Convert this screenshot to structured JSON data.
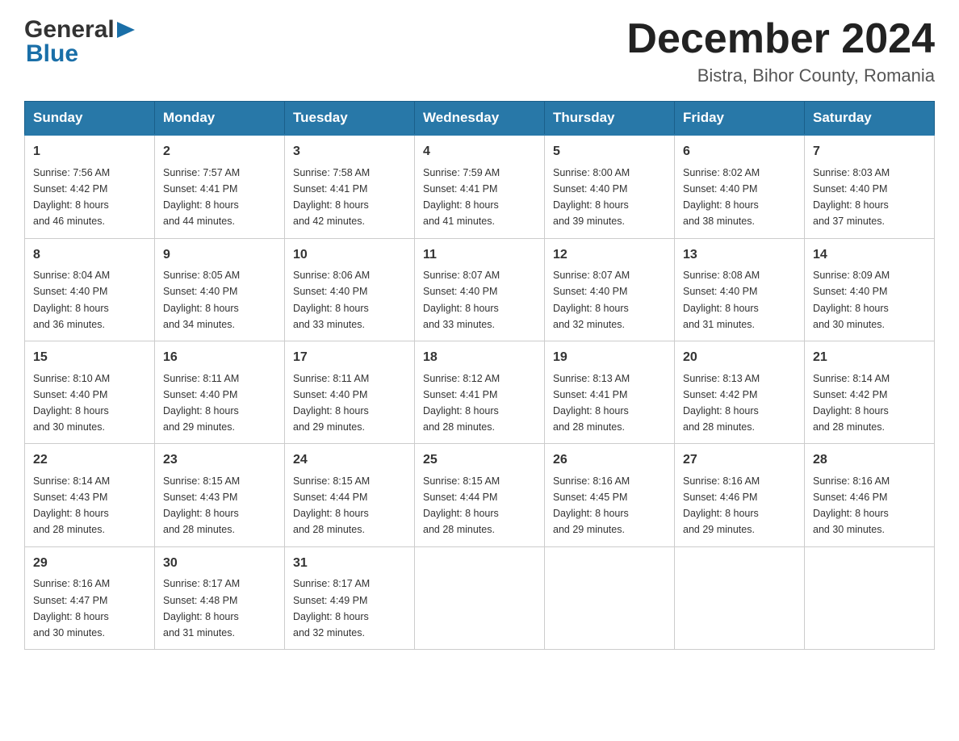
{
  "logo": {
    "general": "General",
    "triangle": "▶",
    "blue": "Blue"
  },
  "title": "December 2024",
  "subtitle": "Bistra, Bihor County, Romania",
  "days_of_week": [
    "Sunday",
    "Monday",
    "Tuesday",
    "Wednesday",
    "Thursday",
    "Friday",
    "Saturday"
  ],
  "weeks": [
    [
      {
        "day": "1",
        "sunrise": "7:56 AM",
        "sunset": "4:42 PM",
        "daylight": "8 hours and 46 minutes."
      },
      {
        "day": "2",
        "sunrise": "7:57 AM",
        "sunset": "4:41 PM",
        "daylight": "8 hours and 44 minutes."
      },
      {
        "day": "3",
        "sunrise": "7:58 AM",
        "sunset": "4:41 PM",
        "daylight": "8 hours and 42 minutes."
      },
      {
        "day": "4",
        "sunrise": "7:59 AM",
        "sunset": "4:41 PM",
        "daylight": "8 hours and 41 minutes."
      },
      {
        "day": "5",
        "sunrise": "8:00 AM",
        "sunset": "4:40 PM",
        "daylight": "8 hours and 39 minutes."
      },
      {
        "day": "6",
        "sunrise": "8:02 AM",
        "sunset": "4:40 PM",
        "daylight": "8 hours and 38 minutes."
      },
      {
        "day": "7",
        "sunrise": "8:03 AM",
        "sunset": "4:40 PM",
        "daylight": "8 hours and 37 minutes."
      }
    ],
    [
      {
        "day": "8",
        "sunrise": "8:04 AM",
        "sunset": "4:40 PM",
        "daylight": "8 hours and 36 minutes."
      },
      {
        "day": "9",
        "sunrise": "8:05 AM",
        "sunset": "4:40 PM",
        "daylight": "8 hours and 34 minutes."
      },
      {
        "day": "10",
        "sunrise": "8:06 AM",
        "sunset": "4:40 PM",
        "daylight": "8 hours and 33 minutes."
      },
      {
        "day": "11",
        "sunrise": "8:07 AM",
        "sunset": "4:40 PM",
        "daylight": "8 hours and 33 minutes."
      },
      {
        "day": "12",
        "sunrise": "8:07 AM",
        "sunset": "4:40 PM",
        "daylight": "8 hours and 32 minutes."
      },
      {
        "day": "13",
        "sunrise": "8:08 AM",
        "sunset": "4:40 PM",
        "daylight": "8 hours and 31 minutes."
      },
      {
        "day": "14",
        "sunrise": "8:09 AM",
        "sunset": "4:40 PM",
        "daylight": "8 hours and 30 minutes."
      }
    ],
    [
      {
        "day": "15",
        "sunrise": "8:10 AM",
        "sunset": "4:40 PM",
        "daylight": "8 hours and 30 minutes."
      },
      {
        "day": "16",
        "sunrise": "8:11 AM",
        "sunset": "4:40 PM",
        "daylight": "8 hours and 29 minutes."
      },
      {
        "day": "17",
        "sunrise": "8:11 AM",
        "sunset": "4:40 PM",
        "daylight": "8 hours and 29 minutes."
      },
      {
        "day": "18",
        "sunrise": "8:12 AM",
        "sunset": "4:41 PM",
        "daylight": "8 hours and 28 minutes."
      },
      {
        "day": "19",
        "sunrise": "8:13 AM",
        "sunset": "4:41 PM",
        "daylight": "8 hours and 28 minutes."
      },
      {
        "day": "20",
        "sunrise": "8:13 AM",
        "sunset": "4:42 PM",
        "daylight": "8 hours and 28 minutes."
      },
      {
        "day": "21",
        "sunrise": "8:14 AM",
        "sunset": "4:42 PM",
        "daylight": "8 hours and 28 minutes."
      }
    ],
    [
      {
        "day": "22",
        "sunrise": "8:14 AM",
        "sunset": "4:43 PM",
        "daylight": "8 hours and 28 minutes."
      },
      {
        "day": "23",
        "sunrise": "8:15 AM",
        "sunset": "4:43 PM",
        "daylight": "8 hours and 28 minutes."
      },
      {
        "day": "24",
        "sunrise": "8:15 AM",
        "sunset": "4:44 PM",
        "daylight": "8 hours and 28 minutes."
      },
      {
        "day": "25",
        "sunrise": "8:15 AM",
        "sunset": "4:44 PM",
        "daylight": "8 hours and 28 minutes."
      },
      {
        "day": "26",
        "sunrise": "8:16 AM",
        "sunset": "4:45 PM",
        "daylight": "8 hours and 29 minutes."
      },
      {
        "day": "27",
        "sunrise": "8:16 AM",
        "sunset": "4:46 PM",
        "daylight": "8 hours and 29 minutes."
      },
      {
        "day": "28",
        "sunrise": "8:16 AM",
        "sunset": "4:46 PM",
        "daylight": "8 hours and 30 minutes."
      }
    ],
    [
      {
        "day": "29",
        "sunrise": "8:16 AM",
        "sunset": "4:47 PM",
        "daylight": "8 hours and 30 minutes."
      },
      {
        "day": "30",
        "sunrise": "8:17 AM",
        "sunset": "4:48 PM",
        "daylight": "8 hours and 31 minutes."
      },
      {
        "day": "31",
        "sunrise": "8:17 AM",
        "sunset": "4:49 PM",
        "daylight": "8 hours and 32 minutes."
      },
      null,
      null,
      null,
      null
    ]
  ],
  "labels": {
    "sunrise": "Sunrise:",
    "sunset": "Sunset:",
    "daylight": "Daylight:"
  }
}
